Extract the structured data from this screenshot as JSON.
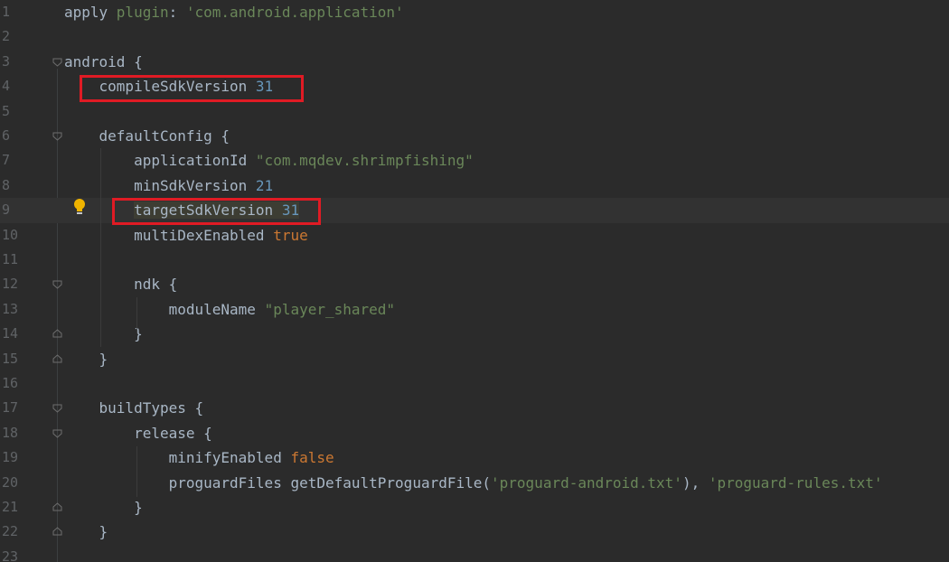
{
  "lines": [
    {
      "n": "1",
      "parts": [
        {
          "t": "apply ",
          "c": ""
        },
        {
          "t": "plugin",
          "c": "grn"
        },
        {
          "t": ": ",
          "c": ""
        },
        {
          "t": "'com.android.application'",
          "c": "str"
        }
      ]
    },
    {
      "n": "2",
      "parts": []
    },
    {
      "n": "3",
      "parts": [
        {
          "t": "android {",
          "c": ""
        }
      ]
    },
    {
      "n": "4",
      "parts": [
        {
          "t": "    compileSdkVersion ",
          "c": ""
        },
        {
          "t": "31",
          "c": "num"
        }
      ]
    },
    {
      "n": "5",
      "parts": []
    },
    {
      "n": "6",
      "parts": [
        {
          "t": "    defaultConfig {",
          "c": ""
        }
      ]
    },
    {
      "n": "7",
      "parts": [
        {
          "t": "        applicationId ",
          "c": ""
        },
        {
          "t": "\"com.mqdev.shrimpfishing\"",
          "c": "str"
        }
      ]
    },
    {
      "n": "8",
      "parts": [
        {
          "t": "        minSdkVersion ",
          "c": ""
        },
        {
          "t": "21",
          "c": "num"
        }
      ]
    },
    {
      "n": "9",
      "parts": [
        {
          "t": "        ",
          "c": ""
        },
        {
          "t": "targetSdkVersion ",
          "c": "sel"
        },
        {
          "t": "31",
          "c": "num sel"
        }
      ]
    },
    {
      "n": "10",
      "parts": [
        {
          "t": "        multiDexEnabled ",
          "c": ""
        },
        {
          "t": "true",
          "c": "kw"
        }
      ]
    },
    {
      "n": "11",
      "parts": []
    },
    {
      "n": "12",
      "parts": [
        {
          "t": "        ndk {",
          "c": ""
        }
      ]
    },
    {
      "n": "13",
      "parts": [
        {
          "t": "            moduleName ",
          "c": ""
        },
        {
          "t": "\"player_shared\"",
          "c": "str"
        }
      ]
    },
    {
      "n": "14",
      "parts": [
        {
          "t": "        }",
          "c": ""
        }
      ]
    },
    {
      "n": "15",
      "parts": [
        {
          "t": "    }",
          "c": ""
        }
      ]
    },
    {
      "n": "16",
      "parts": []
    },
    {
      "n": "17",
      "parts": [
        {
          "t": "    buildTypes {",
          "c": ""
        }
      ]
    },
    {
      "n": "18",
      "parts": [
        {
          "t": "        release {",
          "c": ""
        }
      ]
    },
    {
      "n": "19",
      "parts": [
        {
          "t": "            minifyEnabled ",
          "c": ""
        },
        {
          "t": "false",
          "c": "kw"
        }
      ]
    },
    {
      "n": "20",
      "parts": [
        {
          "t": "            proguardFiles getDefaultProguardFile(",
          "c": ""
        },
        {
          "t": "'proguard-android.txt'",
          "c": "str"
        },
        {
          "t": "), ",
          "c": ""
        },
        {
          "t": "'proguard-rules.txt'",
          "c": "str"
        }
      ]
    },
    {
      "n": "21",
      "parts": [
        {
          "t": "        }",
          "c": ""
        }
      ]
    },
    {
      "n": "22",
      "parts": [
        {
          "t": "    }",
          "c": ""
        }
      ]
    },
    {
      "n": "23",
      "parts": []
    }
  ],
  "current_line": "9",
  "highlighted_lines": [
    "4",
    "9"
  ],
  "colors": {
    "keyword": "#cc7832",
    "string": "#6a8759",
    "number": "#6897bb",
    "highlight_border": "#e01b24"
  },
  "icons": {
    "intention": "lightbulb-icon"
  }
}
